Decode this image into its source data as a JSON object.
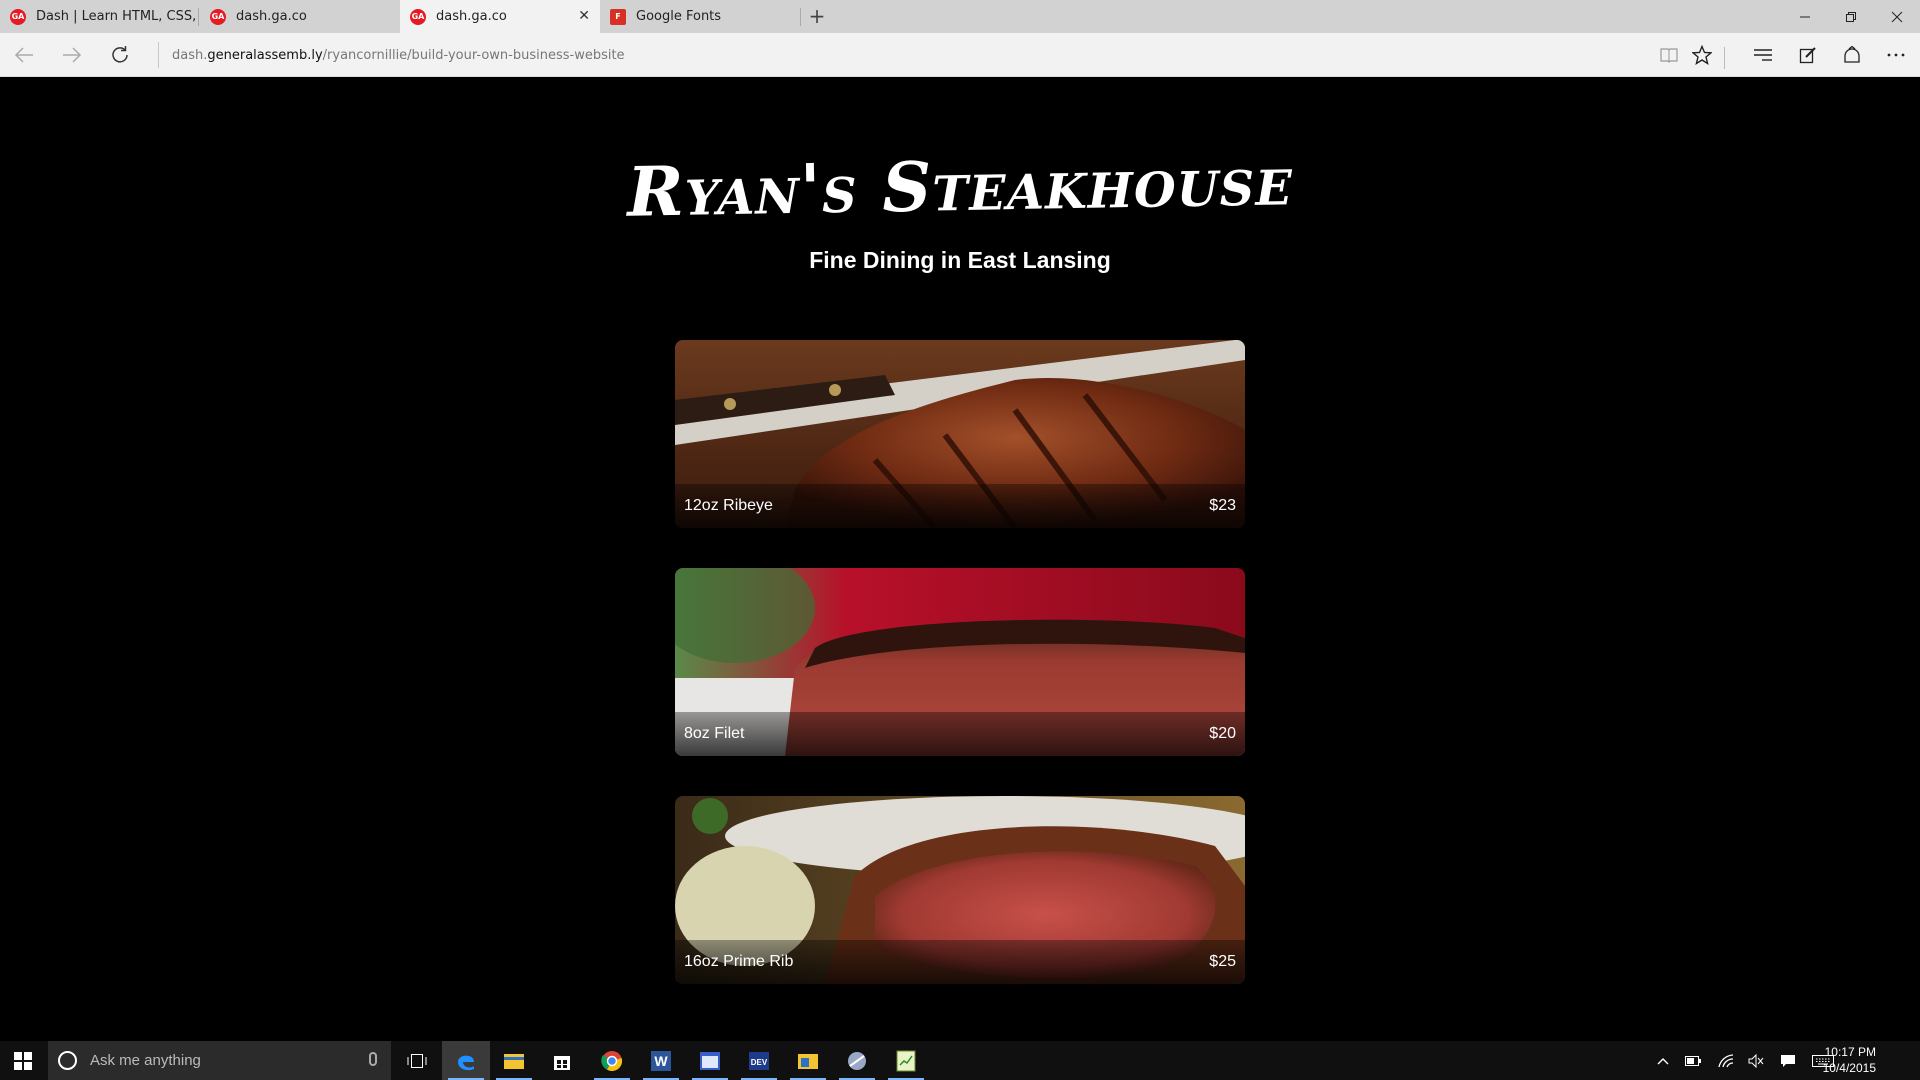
{
  "browser": {
    "tabs": [
      {
        "title": "Dash | Learn HTML, CSS, Jav",
        "active": false
      },
      {
        "title": "dash.ga.co",
        "active": false
      },
      {
        "title": "dash.ga.co",
        "active": true
      },
      {
        "title": "Google Fonts",
        "active": false
      }
    ],
    "close_glyph": "✕",
    "new_tab_glyph": "+",
    "url_prefix": "dash.",
    "url_host": "generalassemb.ly",
    "url_path": "/ryancornillie/build-your-own-business-website"
  },
  "page": {
    "title": "Ryan's Steakhouse",
    "tagline": "Fine Dining in East Lansing",
    "menu": [
      {
        "name": "12oz Ribeye",
        "price": "$23"
      },
      {
        "name": "8oz Filet",
        "price": "$20"
      },
      {
        "name": "16oz Prime Rib",
        "price": "$25"
      }
    ]
  },
  "taskbar": {
    "search_placeholder": "Ask me anything",
    "time": "10:17 PM",
    "date": "10/4/2015"
  }
}
